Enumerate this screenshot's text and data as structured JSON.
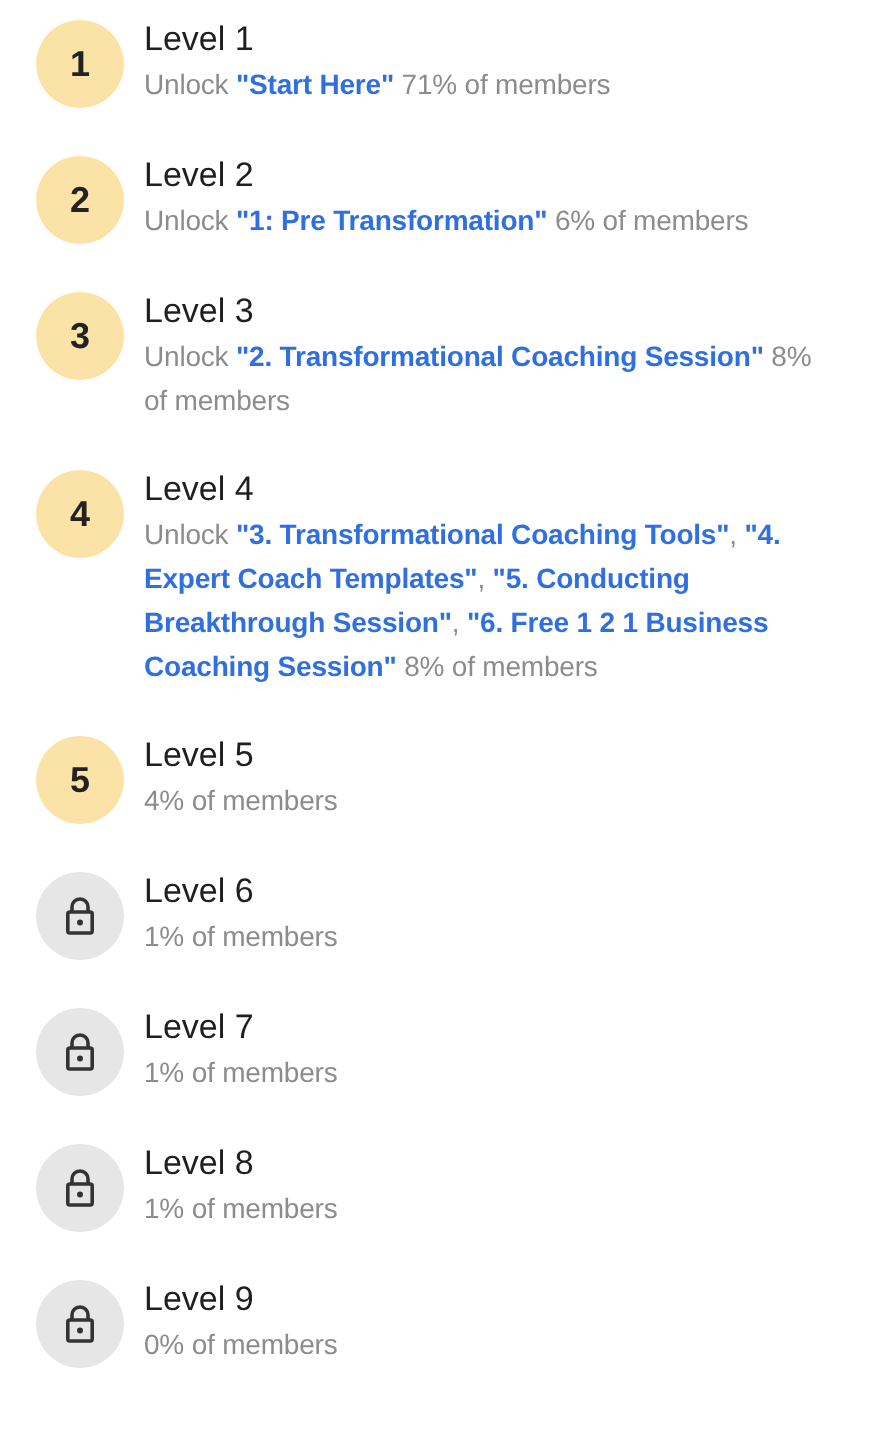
{
  "levels": [
    {
      "title": "Level 1",
      "badge": {
        "kind": "number",
        "text": "1"
      },
      "description": [
        {
          "kind": "plain",
          "text": "Unlock "
        },
        {
          "kind": "highlight",
          "text": "\"Start Here\""
        },
        {
          "kind": "plain",
          "text": " 71% of members"
        }
      ]
    },
    {
      "title": "Level 2",
      "badge": {
        "kind": "number",
        "text": "2"
      },
      "description": [
        {
          "kind": "plain",
          "text": "Unlock "
        },
        {
          "kind": "highlight",
          "text": "\"1: Pre Transformation\""
        },
        {
          "kind": "plain",
          "text": " 6% of members"
        }
      ]
    },
    {
      "title": "Level 3",
      "badge": {
        "kind": "number",
        "text": "3"
      },
      "description": [
        {
          "kind": "plain",
          "text": "Unlock "
        },
        {
          "kind": "highlight",
          "text": "\"2. Transformational Coaching Session\""
        },
        {
          "kind": "plain",
          "text": " 8% of members"
        }
      ]
    },
    {
      "title": "Level 4",
      "badge": {
        "kind": "number",
        "text": "4"
      },
      "description": [
        {
          "kind": "plain",
          "text": "Unlock "
        },
        {
          "kind": "highlight",
          "text": "\"3. Transformational Coaching Tools\""
        },
        {
          "kind": "plain",
          "text": ", "
        },
        {
          "kind": "highlight",
          "text": "\"4. Expert Coach Templates\""
        },
        {
          "kind": "plain",
          "text": ", "
        },
        {
          "kind": "highlight",
          "text": "\"5. Conducting Breakthrough Session\""
        },
        {
          "kind": "plain",
          "text": ", "
        },
        {
          "kind": "highlight",
          "text": "\"6. Free 1 2 1 Business Coaching Session\""
        },
        {
          "kind": "plain",
          "text": " 8% of members"
        }
      ]
    },
    {
      "title": "Level 5",
      "badge": {
        "kind": "number",
        "text": "5"
      },
      "description": [
        {
          "kind": "plain",
          "text": "4% of members"
        }
      ]
    },
    {
      "title": "Level 6",
      "badge": {
        "kind": "locked"
      },
      "description": [
        {
          "kind": "plain",
          "text": "1% of members"
        }
      ]
    },
    {
      "title": "Level 7",
      "badge": {
        "kind": "locked"
      },
      "description": [
        {
          "kind": "plain",
          "text": "1% of members"
        }
      ]
    },
    {
      "title": "Level 8",
      "badge": {
        "kind": "locked"
      },
      "description": [
        {
          "kind": "plain",
          "text": "1% of members"
        }
      ]
    },
    {
      "title": "Level 9",
      "badge": {
        "kind": "locked"
      },
      "description": [
        {
          "kind": "plain",
          "text": "0% of members"
        }
      ]
    }
  ]
}
